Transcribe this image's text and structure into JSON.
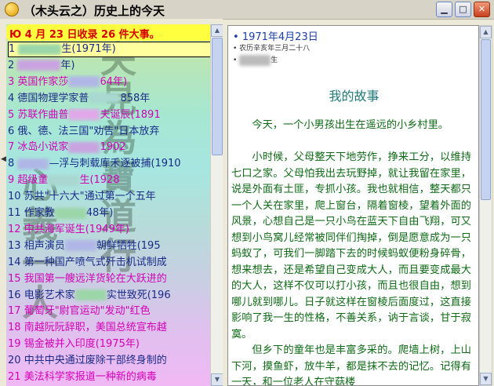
{
  "window": {
    "title": "（木头云之）历史上的今天"
  },
  "left": {
    "header": "Ю 4 月 23 日收录 26 件大事。",
    "items": [
      {
        "no": "1",
        "text": "生(1971年)",
        "color": "#1a2a8a"
      },
      {
        "no": "2",
        "text": "年)",
        "color": "#1a2a8a"
      },
      {
        "no": "3",
        "text": "英国作家莎",
        "tail": "64年)",
        "color": "#d400b8"
      },
      {
        "no": "4",
        "text": "德国物理学家普",
        "tail": "858年",
        "color": "#1a2a8a"
      },
      {
        "no": "5",
        "text": "苏联作曲普",
        "tail": "夫诞辰(1891",
        "color": "#d400b8"
      },
      {
        "no": "6",
        "text": "俄、德、法三国\"劝告\"日本放弃",
        "color": "#1a2a8a"
      },
      {
        "no": "7",
        "text": "冰岛小说家",
        "tail": "1902",
        "color": "#d400b8"
      },
      {
        "no": "8",
        "text": "",
        "tail": "—浮与刺载库禾逐被捕(1910",
        "color": "#1a2a8a"
      },
      {
        "no": "9",
        "text": "超级童",
        "tail": "生(1928",
        "color": "#d400b8"
      },
      {
        "no": "10",
        "text": "苏共\"十六大\"通过第一个五年",
        "color": "#1a2a8a"
      },
      {
        "no": "11",
        "text": "作家教",
        "tail": "48年)",
        "color": "#1a2a8a"
      },
      {
        "no": "12",
        "text": "中共海军诞生(1949年)",
        "color": "#d400b8"
      },
      {
        "no": "13",
        "text": "相声演员",
        "tail": "朝鲜牺牲(195",
        "color": "#1a2a8a"
      },
      {
        "no": "14",
        "text": "第一种国产喷气式歼击机试制成",
        "color": "#1a2a8a"
      },
      {
        "no": "15",
        "text": "我国第一艘远洋货轮在大跃进的",
        "color": "#d400b8"
      },
      {
        "no": "16",
        "text": "电影艺术家",
        "tail": "实世致死(196",
        "color": "#1a2a8a"
      },
      {
        "no": "17",
        "text": "葡萄牙\"尉官运动\"发动\"红色",
        "color": "#d400b8"
      },
      {
        "no": "18",
        "text": "南越阮阮辞职，美国总统宣布越",
        "color": "#d400b8"
      },
      {
        "no": "19",
        "text": "锡金被并入印度(1975年)",
        "color": "#d400b8"
      },
      {
        "no": "20",
        "text": "中共中央通过废除干部终身制的",
        "color": "#1a2a8a"
      },
      {
        "no": "21",
        "text": "美法科学家报道一种新的病毒",
        "color": "#d400b8"
      }
    ]
  },
  "right": {
    "date": "1971年4月23日",
    "lunar": "农历辛亥年三月二十八",
    "extra": "生",
    "story_title": "我的故事",
    "paragraphs": [
      "今天，一个小男孩出生在遥远的小乡村里。",
      "小时候，父母整天下地劳作，挣来工分，以维持七口之家。父母怕我出去玩野掉，就让我留在家里，说是外面有土匪，专抓小孩。我也就相信，整天都只一个人关在家里，爬上窗台，隔着窗棱，望着外面的风景，心想自己是一只小鸟在蓝天下自由飞翔，可又想到小鸟窝儿经常被同伴们掏掉，倒是愿意成为一只蚂蚁了，可我们一脚踏下去的时候蚂蚁便粉身碎骨，想来想去，还是希望自己变成大人，而且要变成最大的大人，这样不仅可以打小孩，而且也很自由，想到哪儿就到哪儿。日子就这样在窗棱后面度过，这直接影响了我一生的性格，不善关系，讷于言谈，甘于寂寞。",
      "但乡下的童年也是丰富多采的。爬墙上树，上山下河，摸鱼虾，放牛羊，都是抹不去的记忆。记得有一天，和一位老人在守菇楼"
    ]
  },
  "colors": {
    "header_bg": "#ffff3f",
    "header_text": "#d60000",
    "link_blue": "#1a3da8",
    "story_green": "#0e6a15"
  }
}
